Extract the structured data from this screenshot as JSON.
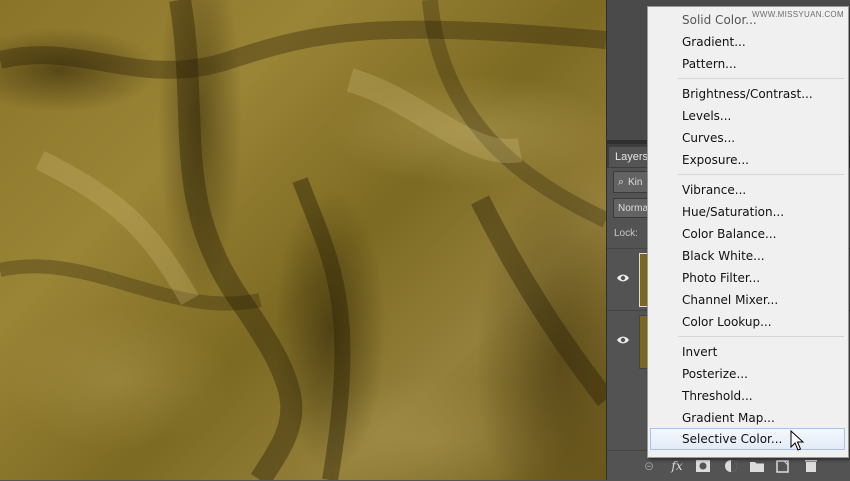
{
  "layers_panel": {
    "tab_label": "Layers",
    "filter_text": "Kin",
    "blend_mode": "Norma",
    "lock_label": "Lock:"
  },
  "menu": {
    "items": [
      "Solid Color...",
      "Gradient...",
      "Pattern...",
      "Brightness/Contrast...",
      "Levels...",
      "Curves...",
      "Exposure...",
      "Vibrance...",
      "Hue/Saturation...",
      "Color Balance...",
      "Black  White...",
      "Photo Filter...",
      "Channel Mixer...",
      "Color Lookup...",
      "Invert",
      "Posterize...",
      "Threshold...",
      "Gradient Map...",
      "Selective Color..."
    ],
    "active_item": "Selective Color..."
  },
  "bottom_bar": {
    "fx_label": "fx"
  },
  "watermark": "WWW.MISSYUAN.COM",
  "colors": {
    "fabric": "#8a7428",
    "panel": "#535353",
    "menu_bg": "#f0f0f0",
    "highlight": "#e2ebf7"
  },
  "icons": [
    "eye-icon",
    "search-icon",
    "link-icon",
    "mask-icon",
    "adjustment-layer-icon",
    "folder-icon",
    "new-layer-icon",
    "trash-icon",
    "mouse-cursor-icon"
  ]
}
